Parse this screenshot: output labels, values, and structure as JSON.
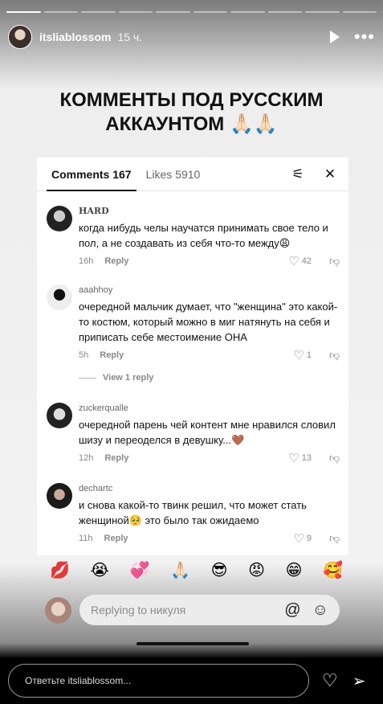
{
  "story": {
    "username": "itsliablossom",
    "time": "15 ч.",
    "headline_line1": "КОММЕНТЫ ПОД РУССКИМ",
    "headline_line2": "АККАУНТОМ 🙏🏻🙏🏻",
    "reply_placeholder": "Ответьте itsliablossom...",
    "segments_done": 1,
    "segments_total": 10
  },
  "tiktok": {
    "tabs": {
      "comments": "Comments 167",
      "likes": "Likes 5910"
    },
    "comments": [
      {
        "name": "HARD",
        "text": "когда нибудь челы научатся принимать свое тело и пол, а не создавать из себя что-то между😩",
        "time": "16h",
        "reply": "Reply",
        "likes": "42"
      },
      {
        "name": "aaahhoy",
        "text": "очередной мальчик думает, что \"женщина\" это какой-то костюм, который можно в миг натянуть на себя и приписать себе местоимение ОНА",
        "time": "5h",
        "reply": "Reply",
        "likes": "1",
        "view_replies": "View 1 reply"
      },
      {
        "name": "zuckerqualle",
        "text": "очередной парень чей контент мне нравился словил шизу и переоделся в девушку...🤎",
        "time": "12h",
        "reply": "Reply",
        "likes": "13"
      },
      {
        "name": "dechartc",
        "text": "и снова какой-то твинк решил, что может стать женщиной🥺 это было так ожидаемо",
        "time": "11h",
        "reply": "Reply",
        "likes": "9"
      }
    ],
    "emojis": [
      "💋",
      "😭",
      "💞",
      "🙏🏻",
      "😎",
      "😡",
      "😁",
      "🥰"
    ],
    "reply_placeholder": "Replying to никуля"
  },
  "icons": {
    "play": "play-icon",
    "more": "more-icon",
    "filter": "filter-icon",
    "close": "close-icon",
    "heart": "heart-icon",
    "dislike": "dislike-icon",
    "at": "at-icon",
    "emoji": "emoji-icon",
    "send": "send-icon"
  }
}
